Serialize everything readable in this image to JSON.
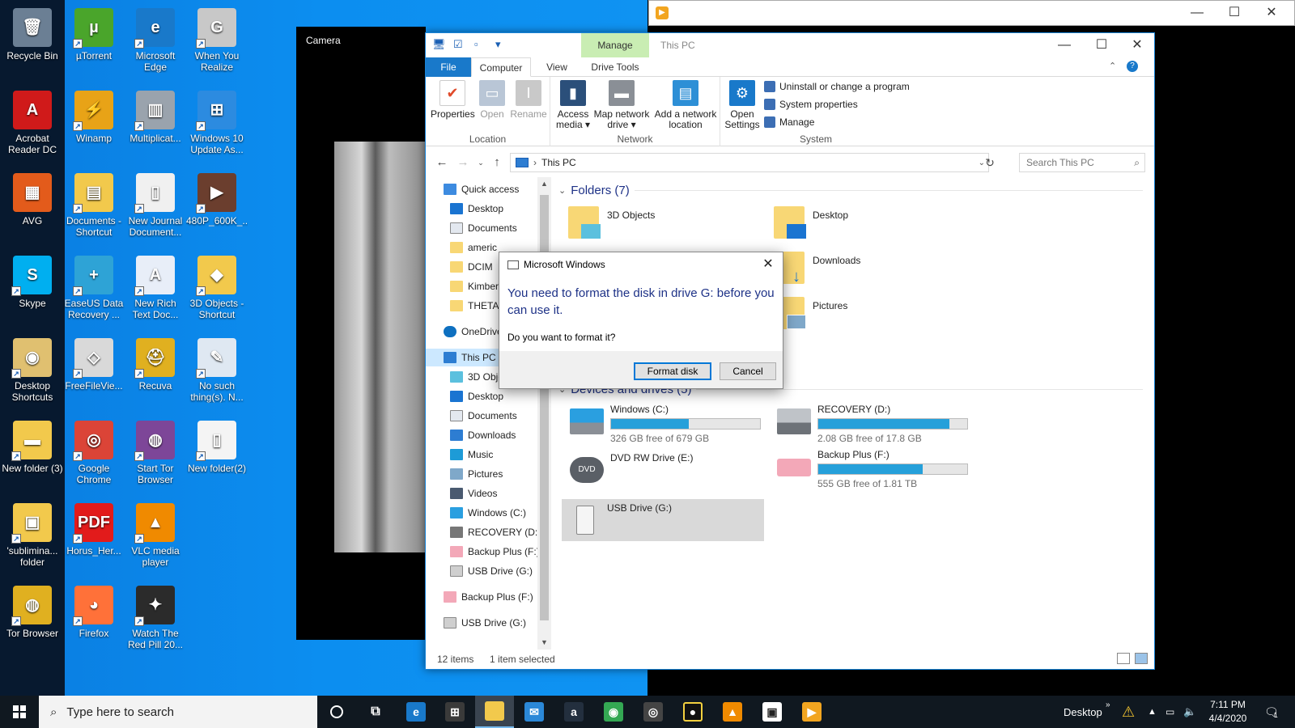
{
  "desktop": {
    "icons": [
      {
        "label": "Recycle Bin",
        "glyph": "🗑",
        "color": "#6b7f94"
      },
      {
        "label": "µTorrent",
        "glyph": "µ",
        "color": "#4aa52b"
      },
      {
        "label": "Microsoft Edge",
        "glyph": "e",
        "color": "#1979ca"
      },
      {
        "label": "When You Realize",
        "glyph": "G",
        "color": "#c8c8c8"
      },
      {
        "label": "Acrobat Reader DC",
        "glyph": "A",
        "color": "#d01a1a"
      },
      {
        "label": "Winamp",
        "glyph": "⚡",
        "color": "#e8a317"
      },
      {
        "label": "Multiplicat...",
        "glyph": "▥",
        "color": "#9aa3ad"
      },
      {
        "label": "Windows 10 Update As...",
        "glyph": "⊞",
        "color": "#2c8be0"
      },
      {
        "label": "AVG",
        "glyph": "▦",
        "color": "#e35b1b"
      },
      {
        "label": "Documents - Shortcut",
        "glyph": "▤",
        "color": "#f2c94c"
      },
      {
        "label": "New Journal Document...",
        "glyph": "▯",
        "color": "#f0f0f0"
      },
      {
        "label": "480P_600K_...",
        "glyph": "▶",
        "color": "#6b3e2e"
      },
      {
        "label": "Skype",
        "glyph": "S",
        "color": "#00aff0"
      },
      {
        "label": "EaseUS Data Recovery ...",
        "glyph": "+",
        "color": "#2ea3d6"
      },
      {
        "label": "New Rich Text Doc...",
        "glyph": "A",
        "color": "#e8eef8"
      },
      {
        "label": "3D Objects - Shortcut",
        "glyph": "◆",
        "color": "#f2c94c"
      },
      {
        "label": "Desktop Shortcuts",
        "glyph": "◉",
        "color": "#e0c070"
      },
      {
        "label": "FreeFileVie...",
        "glyph": "◇",
        "color": "#d9d9d9"
      },
      {
        "label": "Recuva",
        "glyph": "⛑",
        "color": "#e0b020"
      },
      {
        "label": "No such thing(s). N...",
        "glyph": "✎",
        "color": "#dfe8f2"
      },
      {
        "label": "New folder (3)",
        "glyph": "▬",
        "color": "#f2c94c"
      },
      {
        "label": "Google Chrome",
        "glyph": "◎",
        "color": "#db4437"
      },
      {
        "label": "Start Tor Browser",
        "glyph": "◍",
        "color": "#7d4698"
      },
      {
        "label": "New folder(2)",
        "glyph": "▯",
        "color": "#f4f4f4"
      },
      {
        "label": "'sublimina... folder",
        "glyph": "▣",
        "color": "#f2c94c"
      },
      {
        "label": "Horus_Her...",
        "glyph": "PDF",
        "color": "#e21b1b"
      },
      {
        "label": "VLC media player",
        "glyph": "▲",
        "color": "#f08a00"
      },
      {
        "label": "Tor Browser",
        "glyph": "◍",
        "color": "#e0b020"
      },
      {
        "label": "Firefox",
        "glyph": "◕",
        "color": "#ff7139"
      },
      {
        "label": "Watch The Red Pill 20...",
        "glyph": "✦",
        "color": "#2b2b2b"
      }
    ]
  },
  "camera": {
    "title": "Camera"
  },
  "explorer": {
    "title": "This PC",
    "manage_tab": "Manage",
    "tabs": {
      "file": "File",
      "computer": "Computer",
      "view": "View",
      "drive_tools": "Drive Tools"
    },
    "ribbon": {
      "location": {
        "name": "Location",
        "properties": "Properties",
        "open": "Open",
        "rename": "Rename"
      },
      "network": {
        "name": "Network",
        "access_media": "Access media ▾",
        "map_drive": "Map network drive ▾",
        "add_location": "Add a network location"
      },
      "system": {
        "name": "System",
        "open_settings": "Open Settings",
        "uninstall": "Uninstall or change a program",
        "sys_props": "System properties",
        "manage": "Manage"
      }
    },
    "address": "This PC",
    "search_placeholder": "Search This PC",
    "nav": {
      "quick_access": "Quick access",
      "desktop": "Desktop",
      "documents": "Documents",
      "americ": "americ",
      "dcim": "DCIM",
      "kimber": "Kimber",
      "theta": "THETA",
      "onedrive": "OneDrive",
      "this_pc": "This PC",
      "objects3d": "3D Objects",
      "desktop2": "Desktop",
      "documents2": "Documents",
      "downloads": "Downloads",
      "music": "Music",
      "pictures": "Pictures",
      "videos": "Videos",
      "windows_c": "Windows (C:)",
      "recovery_d": "RECOVERY (D:)",
      "backup_f": "Backup Plus (F:)",
      "usb_g": "USB Drive (G:)",
      "backup_f2": "Backup Plus (F:)",
      "usb_g2": "USB Drive (G:)"
    },
    "folders_header": "Folders (7)",
    "folders": {
      "objects3d": "3D Objects",
      "desktop": "Desktop",
      "downloads": "Downloads",
      "pictures": "Pictures"
    },
    "devices_header": "Devices and drives (5)",
    "drives": {
      "c": {
        "name": "Windows (C:)",
        "free": "326 GB free of 679 GB",
        "used_fraction": 0.52
      },
      "d": {
        "name": "RECOVERY (D:)",
        "free": "2.08 GB free of 17.8 GB",
        "used_fraction": 0.88
      },
      "e": {
        "name": "DVD RW Drive (E:)",
        "badge": "DVD"
      },
      "f": {
        "name": "Backup Plus (F:)",
        "free": "555 GB free of 1.81 TB",
        "used_fraction": 0.7
      },
      "g": {
        "name": "USB Drive (G:)"
      }
    },
    "status": {
      "items": "12 items",
      "selected": "1 item selected"
    }
  },
  "dialog": {
    "title": "Microsoft Windows",
    "message": "You need to format the disk in drive G: before you can use it.",
    "question": "Do you want to format it?",
    "format_btn": "Format disk",
    "cancel_btn": "Cancel"
  },
  "taskbar": {
    "search_placeholder": "Type here to search",
    "desktop_label": "Desktop",
    "time": "7:11 PM",
    "date": "4/4/2020",
    "notification_count": "1"
  }
}
